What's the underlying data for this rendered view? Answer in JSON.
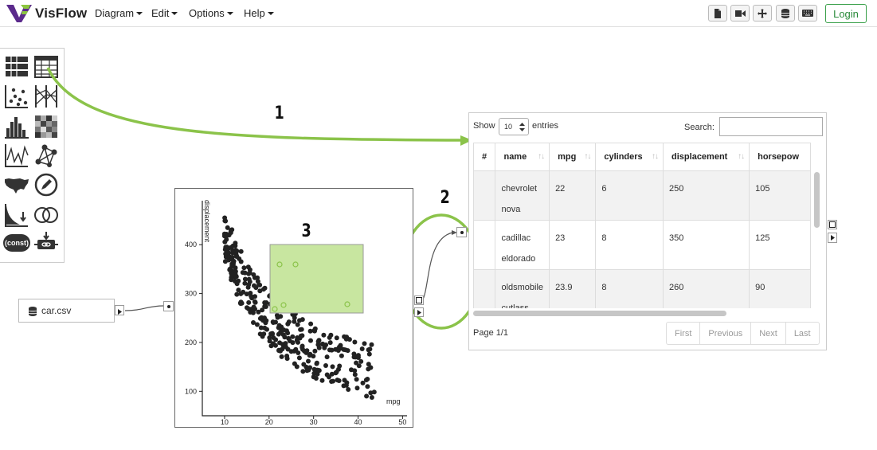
{
  "app": {
    "name": "VisFlow"
  },
  "nav": {
    "menus": [
      {
        "label": "Diagram"
      },
      {
        "label": "Edit"
      },
      {
        "label": "Options"
      },
      {
        "label": "Help"
      }
    ],
    "toolbar_icons": [
      "file-icon",
      "video-icon",
      "move-icon",
      "database-icon",
      "keyboard-icon"
    ],
    "login_label": "Login"
  },
  "palette": {
    "icons": [
      "table-list-icon",
      "data-table-icon",
      "scatterplot-icon",
      "parallel-coordinates-icon",
      "histogram-icon",
      "heatmap-icon",
      "line-chart-icon",
      "network-icon",
      "map-icon",
      "visual-editor-icon",
      "density-icon",
      "set-operator-icon",
      "constant-icon",
      "attribute-filter-icon"
    ],
    "const_label": "(const)"
  },
  "csv_node": {
    "label": "car.csv"
  },
  "scatter": {
    "xlabel": "mpg",
    "ylabel": "displacement",
    "xticks": [
      10,
      20,
      30,
      40,
      50
    ],
    "yticks": [
      100,
      200,
      300,
      400
    ],
    "selection_marker_color": "#8bc34a",
    "selection_fill": "#c8e6a0"
  },
  "annotations": [
    "1",
    "2",
    "3"
  ],
  "table": {
    "show_label": "Show",
    "entries_value": "10",
    "entries_label": "entries",
    "search_label": "Search:",
    "columns": [
      "#",
      "name",
      "mpg",
      "cylinders",
      "displacement",
      "horsepow"
    ],
    "rows": [
      {
        "num": "",
        "name": "chevrolet nova",
        "mpg": "22",
        "cylinders": "6",
        "displacement": "250",
        "horsepower": "105"
      },
      {
        "num": "",
        "name": "cadillac eldorado",
        "mpg": "23",
        "cylinders": "8",
        "displacement": "350",
        "horsepower": "125"
      },
      {
        "num": "",
        "name": "oldsmobile cutlass",
        "mpg": "23.9",
        "cylinders": "8",
        "displacement": "260",
        "horsepower": "90"
      }
    ],
    "page_label": "Page 1/1",
    "pager": [
      "First",
      "Previous",
      "Next",
      "Last"
    ]
  },
  "colors": {
    "accent_green": "#8bc34a",
    "brand_purple": "#5b2a8c",
    "brand_green": "#8cc63f"
  }
}
